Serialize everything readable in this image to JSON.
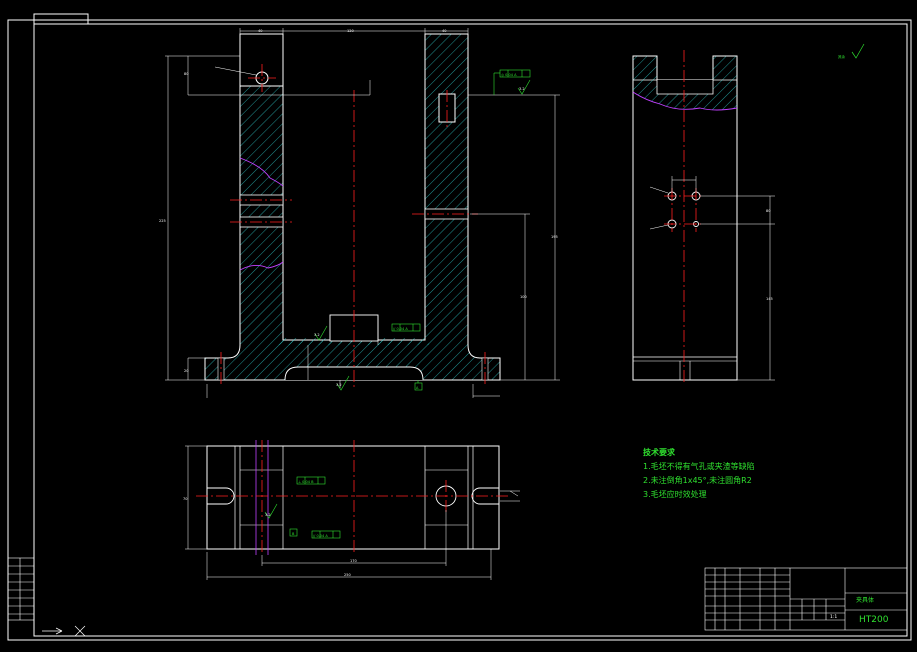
{
  "drawing": {
    "material": "HT200",
    "part_name": "夹具体",
    "scale": "1:1",
    "roughness_symbol": "其余",
    "technical_requirements": {
      "title": "技术要求",
      "items": [
        "1.毛坯不得有气孔或夹渣等缺陷",
        "2.未注倒角1x45°,未注圆角R2",
        "3.毛坯应时效处理"
      ]
    },
    "datum_labels": [
      "A",
      "B"
    ],
    "tolerance_frames": [
      "◎ 0.04 A",
      "// 0.04 A",
      "⊥ 0.04 B",
      "// 0.04 A"
    ],
    "roughness_values": [
      "3.2",
      "3.2",
      "3.2",
      "3.2"
    ],
    "dimension_labels": {
      "front_top": [
        "40",
        "120",
        "40"
      ],
      "front_left": [
        "80",
        "225",
        "20"
      ],
      "front_right": [
        "195",
        "100"
      ],
      "side_right": [
        "80",
        "145"
      ],
      "plan_bottom": [
        "250",
        "170"
      ],
      "plan_left": [
        "70"
      ]
    }
  },
  "colors": {
    "background": "#000000",
    "line": "#ffffff",
    "center": "#ff2020",
    "hatch": "#2fd0d0",
    "text_green": "#2fe02f",
    "break": "#c040ff"
  }
}
